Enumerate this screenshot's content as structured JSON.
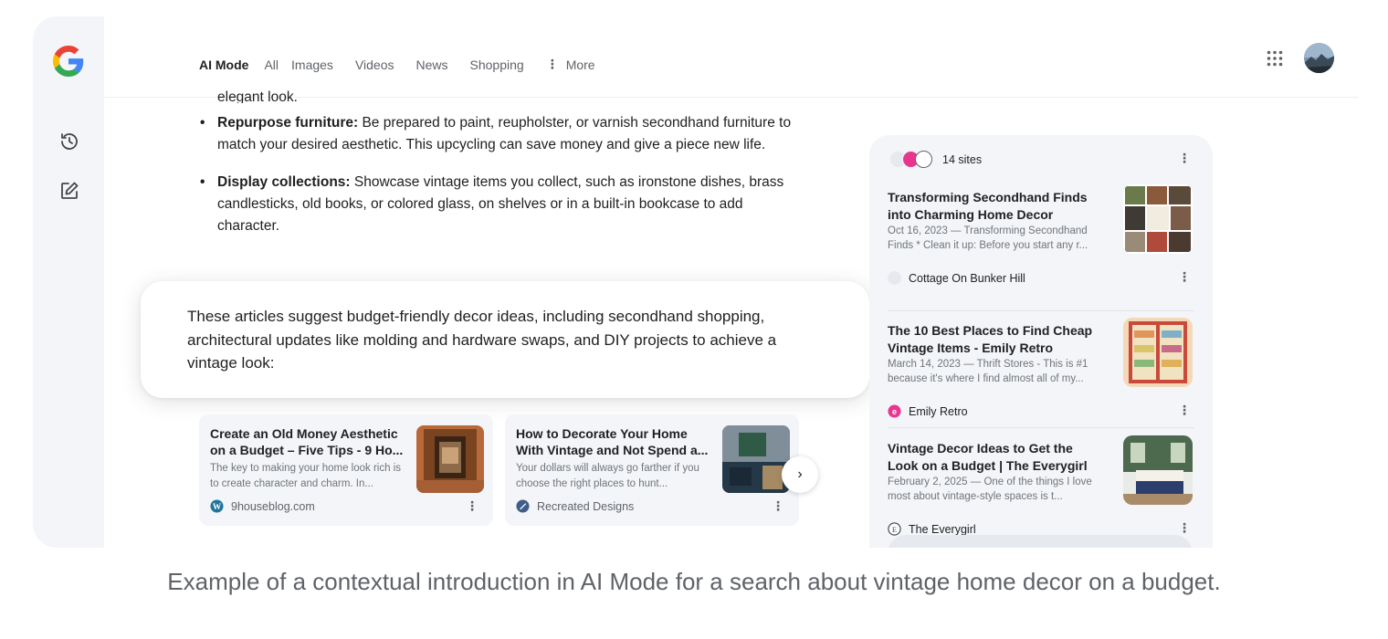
{
  "nav": {
    "tabs": [
      {
        "label": "AI Mode",
        "active": true
      },
      {
        "label": "All"
      },
      {
        "label": "Images"
      },
      {
        "label": "Videos"
      },
      {
        "label": "News"
      },
      {
        "label": "Shopping"
      }
    ],
    "more_label": "More"
  },
  "sidebar": {
    "icons": [
      "history-icon",
      "new-chat-icon"
    ]
  },
  "answer": {
    "cut_line": "elegant look.",
    "bullets": [
      {
        "term": "Repurpose furniture:",
        "text": " Be prepared to paint, reupholster, or varnish secondhand furniture to match your desired aesthetic. This upcycling can save money and give a piece new life."
      },
      {
        "term": "Display collections:",
        "text": " Showcase vintage items you collect, such as ironstone dishes, brass candlesticks, old books, or colored glass, on shelves or in a built-in bookcase to add character."
      }
    ],
    "intro": "These articles suggest budget-friendly decor ideas, including secondhand shopping, architectural updates like molding and hardware swaps, and DIY projects to achieve a vintage look:"
  },
  "link_cards": [
    {
      "title": "Create an Old Money Aesthetic on a Budget – Five Tips - 9 Ho...",
      "snippet": "The key to making your home look rich is to create character and charm. In...",
      "source": "9houseblog.com"
    },
    {
      "title": "How to Decorate Your Home With Vintage and Not Spend a...",
      "snippet": "Your dollars will always go farther if you choose the right places to hunt...",
      "source": "Recreated Designs"
    }
  ],
  "sources_panel": {
    "count_label": "14 sites",
    "items": [
      {
        "title": "Transforming Secondhand Finds into Charming Home Decor",
        "snippet": "Oct 16, 2023 — Transforming Secondhand Finds * Clean it up: Before you start any r...",
        "site": "Cottage On Bunker Hill"
      },
      {
        "title": "The 10 Best Places to Find Cheap Vintage Items - Emily Retro",
        "snippet": "March 14, 2023 — Thrift Stores - This is #1 because it's where I find almost all of my...",
        "site": "Emily Retro"
      },
      {
        "title": "Vintage Decor Ideas to Get the Look on a Budget | The Everygirl",
        "snippet": "February 2, 2025 — One of the things I love most about vintage-style spaces is t...",
        "site": "The Everygirl"
      }
    ]
  },
  "caption": "Example of a contextual introduction in AI Mode for a search about vintage home decor on a budget.",
  "colors": {
    "emily_retro_pink": "#e8368f",
    "panel_bg": "#f3f5f8",
    "caption_gray": "#5f6368"
  }
}
